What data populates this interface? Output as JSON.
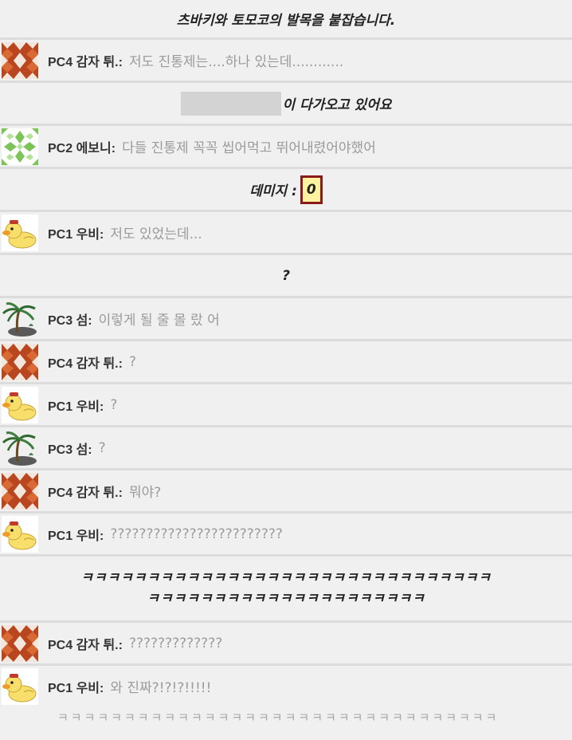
{
  "title": "츠바키와 토모코의 발목을 붙잡습니다.",
  "approach_text": "이 다가오고 있어요",
  "damage": {
    "label": "데미지 :",
    "value": "0"
  },
  "question": "?",
  "laugh_big_1": "ㅋㅋㅋㅋㅋㅋㅋㅋㅋㅋㅋㅋㅋㅋㅋㅋㅋㅋㅋㅋㅋㅋㅋㅋㅋㅋㅋㅋㅋㅋㅋ",
  "laugh_big_2": "ㅋㅋㅋㅋㅋㅋㅋㅋㅋㅋㅋㅋㅋㅋㅋㅋㅋㅋㅋㅋㅋ",
  "messages": [
    {
      "speaker": "PC4 감자 튀.:",
      "text": "저도 진통제는....하나 있는데............",
      "avatar": "red-quilt-avatar-icon"
    },
    {
      "speaker": "PC2 에보니:",
      "text": "다들 진통제 꼭꼭 씹어먹고 뛰어내렸어야했어",
      "avatar": "green-pattern-avatar-icon"
    },
    {
      "speaker": "PC1 우비:",
      "text": "저도 있었는데...",
      "avatar": "yellow-duck-avatar-icon"
    },
    {
      "speaker": "PC3 섬:",
      "text": "이렇게 될 줄 몰 랐 어",
      "avatar": "palm-island-avatar-icon"
    },
    {
      "speaker": "PC4 감자 튀.:",
      "text": "?",
      "avatar": "red-quilt-avatar-icon"
    },
    {
      "speaker": "PC1 우비:",
      "text": "?",
      "avatar": "yellow-duck-avatar-icon"
    },
    {
      "speaker": "PC3 섬:",
      "text": "?",
      "avatar": "palm-island-avatar-icon"
    },
    {
      "speaker": "PC4 감자 튀.:",
      "text": "뭐야?",
      "avatar": "red-quilt-avatar-icon"
    },
    {
      "speaker": "PC1 우비:",
      "text": "????????????????????????",
      "avatar": "yellow-duck-avatar-icon"
    },
    {
      "speaker": "PC4 감자 튀.:",
      "text": "?????????????",
      "avatar": "red-quilt-avatar-icon"
    },
    {
      "speaker": "PC1 우비:",
      "text": "와 진짜?!?!?!!!!!",
      "avatar": "yellow-duck-avatar-icon"
    }
  ],
  "footer_text": "ㅋㅋㅋㅋㅋㅋㅋㅋㅋㅋㅋㅋㅋㅋㅋㅋㅋㅋㅋㅋㅋㅋㅋㅋㅋㅋㅋㅋㅋㅋㅋㅋㅋ",
  "colors": {
    "background": "#f0f0f0",
    "separator": "#dcdcdc",
    "message_text": "#9b9b9b",
    "damage_box_fill": "#fff2a0",
    "damage_box_border": "#8b1a1a"
  }
}
